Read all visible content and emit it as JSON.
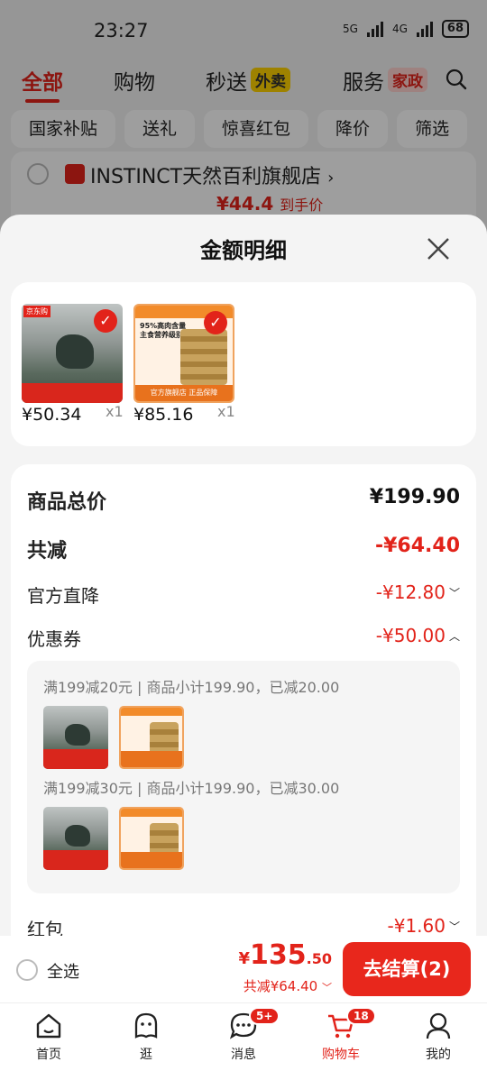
{
  "status_bar": {
    "time": "23:27",
    "network_1": "5G",
    "network_2": "4G",
    "battery": "68"
  },
  "top_tabs": [
    {
      "label": "全部",
      "active": true
    },
    {
      "label": "购物"
    },
    {
      "label": "秒送",
      "tag": "外卖"
    },
    {
      "label": "服务",
      "tag": "家政"
    }
  ],
  "filter_chips": [
    "国家补贴",
    "送礼",
    "惊喜红包",
    "降价",
    "筛选"
  ],
  "store": {
    "name": "INSTINCT天然百利旗舰店",
    "chevron": "›",
    "price": "¥44.4",
    "price_suffix": "到手价"
  },
  "sheet": {
    "title": "金额明细",
    "products": [
      {
        "price": "¥50.34",
        "qty": "x1",
        "jd_tag": "京东购"
      },
      {
        "price": "¥85.16",
        "qty": "x1",
        "headline": "95%高肉含量 主食营养级别",
        "footer": "官方旗舰店 正品保障"
      }
    ],
    "rows": {
      "total_label": "商品总价",
      "total_value": "¥199.90",
      "reduce_label": "共减",
      "reduce_value": "-¥64.40",
      "official_label": "官方直降",
      "official_value": "-¥12.80",
      "coupon_label": "优惠券",
      "coupon_value": "-¥50.00",
      "hongbao_label": "红包",
      "hongbao_value": "-¥1.60"
    },
    "coupons": [
      "满199减20元 | 商品小计199.90，已减20.00",
      "满199减30元 | 商品小计199.90，已减30.00"
    ]
  },
  "checkout": {
    "select_all": "全选",
    "currency": "¥",
    "total_int": "135",
    "total_dec": ".50",
    "saved": "共减¥64.40",
    "button": "去结算(2)"
  },
  "nav": [
    {
      "label": "首页",
      "icon": "home-icon"
    },
    {
      "label": "逛",
      "icon": "ghost-icon"
    },
    {
      "label": "消息",
      "icon": "message-icon",
      "badge": "5+"
    },
    {
      "label": "购物车",
      "icon": "cart-icon",
      "badge": "18",
      "active": true
    },
    {
      "label": "我的",
      "icon": "profile-icon"
    }
  ],
  "colors": {
    "accent": "#e2231a",
    "button": "#e8271c"
  }
}
